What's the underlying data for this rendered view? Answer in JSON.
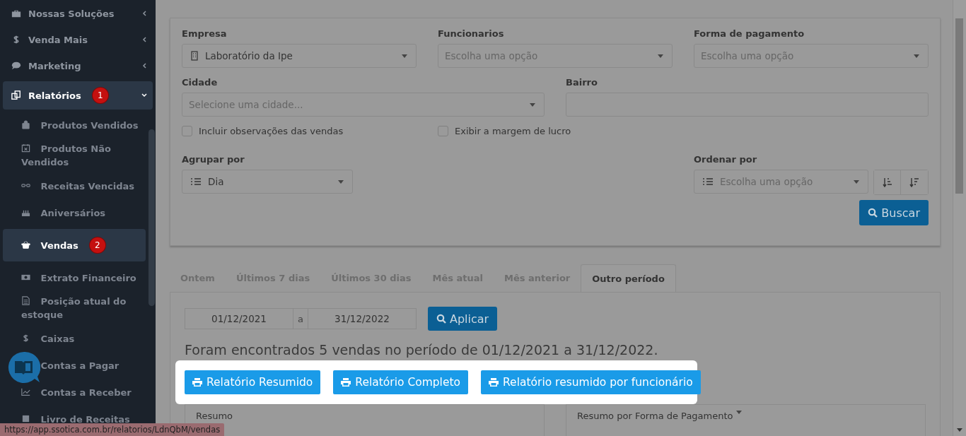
{
  "sidebar": {
    "items": [
      {
        "label": "Nossas Soluções",
        "expanded": false,
        "selected": false
      },
      {
        "label": "Venda Mais",
        "expanded": false,
        "selected": false
      },
      {
        "label": "Marketing",
        "expanded": false,
        "selected": false
      },
      {
        "label": "Relatórios",
        "badge": "1",
        "expanded": true,
        "selected": true,
        "children": [
          {
            "label": "Produtos Vendidos",
            "selected": false
          },
          {
            "label": "Produtos Não Vendidos",
            "selected": false
          },
          {
            "label": "Receitas Vencidas",
            "selected": false
          },
          {
            "label": "Aniversários",
            "selected": false
          },
          {
            "label": "Vendas",
            "badge": "2",
            "selected": true
          },
          {
            "label": "Extrato Financeiro",
            "selected": false
          },
          {
            "label": "Posição atual do estoque",
            "selected": false
          },
          {
            "label": "Caixas",
            "selected": false
          },
          {
            "label": "Contas a Pagar",
            "selected": false
          },
          {
            "label": "Contas a Receber",
            "selected": false
          },
          {
            "label": "Livro de Receitas",
            "selected": false
          }
        ]
      }
    ]
  },
  "filters": {
    "empresa": {
      "label": "Empresa",
      "value": "Laboratório da Ipe"
    },
    "funcionarios": {
      "label": "Funcionarios",
      "placeholder": "Escolha uma opção"
    },
    "forma_pagamento": {
      "label": "Forma de pagamento",
      "placeholder": "Escolha uma opção"
    },
    "cidade": {
      "label": "Cidade",
      "placeholder": "Selecione uma cidade..."
    },
    "bairro": {
      "label": "Bairro"
    },
    "checkboxes": [
      {
        "label": "Incluir observações das vendas",
        "checked": false
      },
      {
        "label": "Exibir a margem de lucro",
        "checked": false
      }
    ],
    "agrupar": {
      "label": "Agrupar por",
      "value": "Dia"
    },
    "ordenar": {
      "label": "Ordenar por",
      "placeholder": "Escolha uma opção"
    },
    "search_button": "Buscar"
  },
  "tabs": [
    {
      "label": "Ontem",
      "selected": false
    },
    {
      "label": "Últimos 7 dias",
      "selected": false
    },
    {
      "label": "Últimos 30 dias",
      "selected": false
    },
    {
      "label": "Mês atual",
      "selected": false
    },
    {
      "label": "Mês anterior",
      "selected": false
    },
    {
      "label": "Outro período",
      "selected": true
    }
  ],
  "period": {
    "from": "01/12/2021",
    "separator": "a",
    "to": "31/12/2022",
    "apply_button": "Aplicar"
  },
  "result_text": "Foram encontrados 5 vendas no período de 01/12/2021 a 31/12/2022.",
  "report_buttons": [
    "Relatório Resumido",
    "Relatório Completo",
    "Relatório resumido por funcionário"
  ],
  "panels": [
    {
      "title": "Resumo",
      "dropdown": false
    },
    {
      "title": "Resumo por Forma de Pagamento",
      "dropdown": true
    }
  ],
  "status_bar": "https://app.ssotica.com.br/relatorios/LdnQbM/vendas"
}
